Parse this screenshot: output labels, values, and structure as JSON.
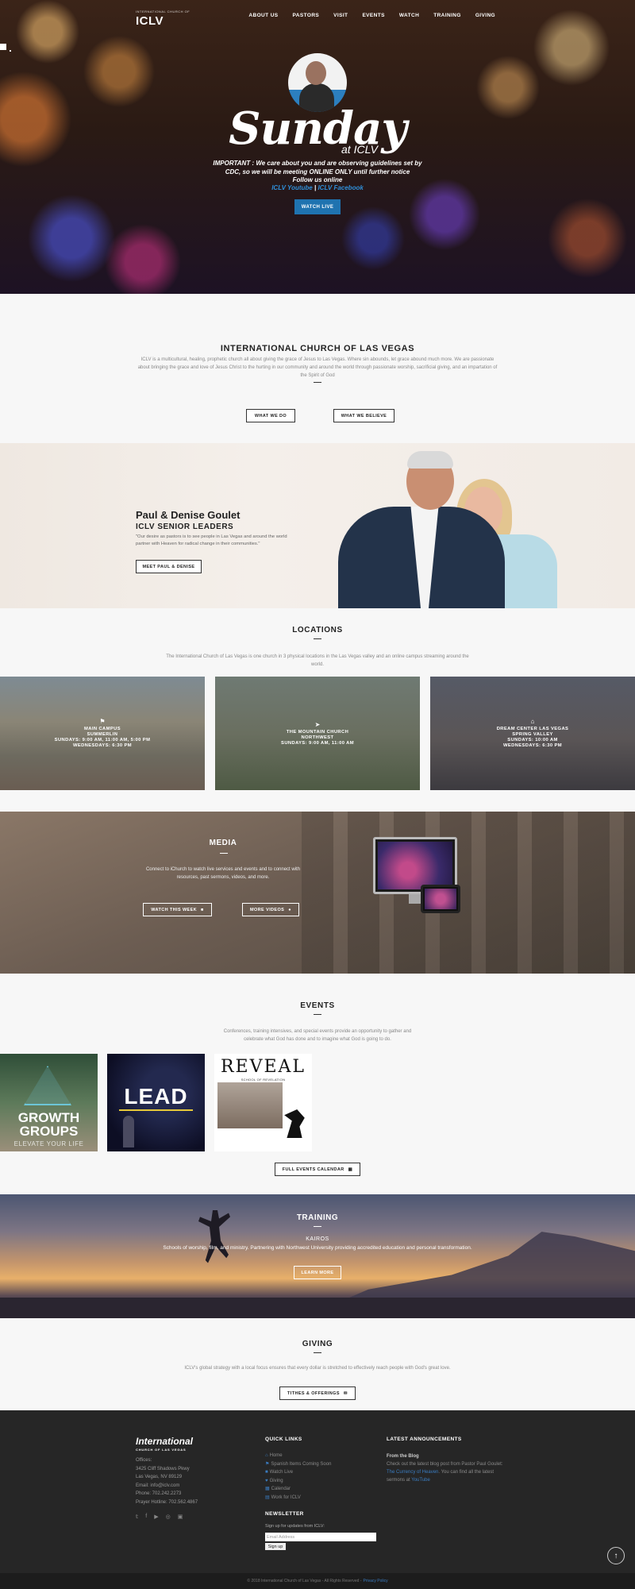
{
  "header": {
    "logo_small": "INTERNATIONAL CHURCH OF",
    "logo": "ICLV",
    "nav": [
      "ABOUT US",
      "PASTORS",
      "VISIT",
      "EVENTS",
      "WATCH",
      "TRAINING",
      "GIVING"
    ]
  },
  "hero": {
    "title": "Sunday",
    "title_sub": "at ICLV",
    "notice_line1": "IMPORTANT : We care about you and are observing guidelines set by",
    "notice_line2": "CDC, so we will be meeting ONLINE ONLY until further notice",
    "notice_line3": "Follow us online",
    "link_youtube": "ICLV Youtube",
    "link_sep": " | ",
    "link_facebook": "ICLV Facebook",
    "button": "WATCH LIVE"
  },
  "intro": {
    "title": "INTERNATIONAL CHURCH OF LAS VEGAS",
    "text": "ICLV is a multicultural, healing, prophetic church all about giving the grace of Jesus to Las Vegas. Where sin abounds, let grace abound much more. We are passionate about bringing the grace and love of Jesus Christ to the hurting in our community and around the world through passionate worship, sacrificial giving, and an impartation of the Spirit of God",
    "button_do": "WHAT WE DO",
    "button_believe": "WHAT WE BELIEVE"
  },
  "pastors": {
    "name": "Paul & Denise Goulet",
    "subtitle": "ICLV SENIOR LEADERS",
    "quote": "\"Our desire as pastors is to see people in Las Vegas and around the world partner with Heaven for radical change in their communities.\"",
    "button": "MEET PAUL & DENISE"
  },
  "locations": {
    "title": "LOCATIONS",
    "text": "The International Church of Las Vegas is one church in 3 physical locations in the Las Vegas valley and an online campus streaming around the world.",
    "items": [
      {
        "name": "MAIN CAMPUS",
        "line2": "SUMMERLIN",
        "line3": "SUNDAYS: 9:00 AM, 11:00 AM, 5:00 PM",
        "line4": "WEDNESDAYS: 6:30 PM"
      },
      {
        "name": "THE MOUNTAIN CHURCH",
        "line2": "NORTHWEST",
        "line3": "SUNDAYS: 9:00 AM, 11:00 AM",
        "line4": ""
      },
      {
        "name": "DREAM CENTER LAS VEGAS",
        "line2": "SPRING VALLEY",
        "line3": "SUNDAYS: 10:00 AM",
        "line4": "WEDNESDAYS: 6:30 PM"
      }
    ]
  },
  "media": {
    "title": "MEDIA",
    "text": "Connect to iChurch to watch live services and events and to connect with resources, past sermons, videos, and more.",
    "button_watch": "WATCH THIS WEEK",
    "button_more": "MORE VIDEOS"
  },
  "events": {
    "title": "EVENTS",
    "text": "Conferences, training intensives, and special events provide an opportunity to gather and celebrate what God has done and to imagine what God is going to do.",
    "card1_title": "GROWTH GROUPS",
    "card1_sub": "ELEVATE YOUR LIFE",
    "card2_title": "LEAD",
    "card3_title": "REVEAL",
    "card3_sub": "SCHOOL OF REVELATION",
    "button": "FULL EVENTS CALENDAR"
  },
  "training": {
    "title": "TRAINING",
    "sub": "KAIROS",
    "text": "Schools of worship, film, and ministry. Partnering with Northwest University providing accredited education and personal transformation.",
    "button": "LEARN MORE"
  },
  "giving": {
    "title": "GIVING",
    "text": "ICLV's global strategy with a local focus ensures that every dollar is stretched to effectively reach people with God's great love.",
    "button": "TITHES & OFFERINGS"
  },
  "footer": {
    "logo": "International",
    "logo_sub": "CHURCH OF LAS VEGAS",
    "contact": [
      "Offices:",
      "3425 Cliff Shadows Pkwy",
      "Las Vegas, NV 89129",
      "Email: info@iclv.com",
      "Phone: 702.242.2273",
      "Prayer Hotline: 702.562.4867"
    ],
    "quick_links_title": "QUICK LINKS",
    "quick_links": [
      "Home",
      "Spanish Items Coming Soon",
      "Watch Live",
      "Giving",
      "Calendar",
      "Work for ICLV"
    ],
    "announcements_title": "LATEST ANNOUNCEMENTS",
    "ann_heading": "From the Blog",
    "ann_text1": "Check out the latest blog post from Pastor Paul Goulet: ",
    "ann_link1": "The Currency of Heaven",
    "ann_text2": ". You can find all the latest sermons at ",
    "ann_link2": "YouTube",
    "newsletter_title": "NEWSLETTER",
    "newsletter_text": "Sign up for updates from ICLV:",
    "email_placeholder": "Email Address",
    "signup": "Sign up",
    "copyright": "© 2018 International Church of Las Vegas - All Rights Reserved -",
    "privacy": "Privacy Policy"
  }
}
